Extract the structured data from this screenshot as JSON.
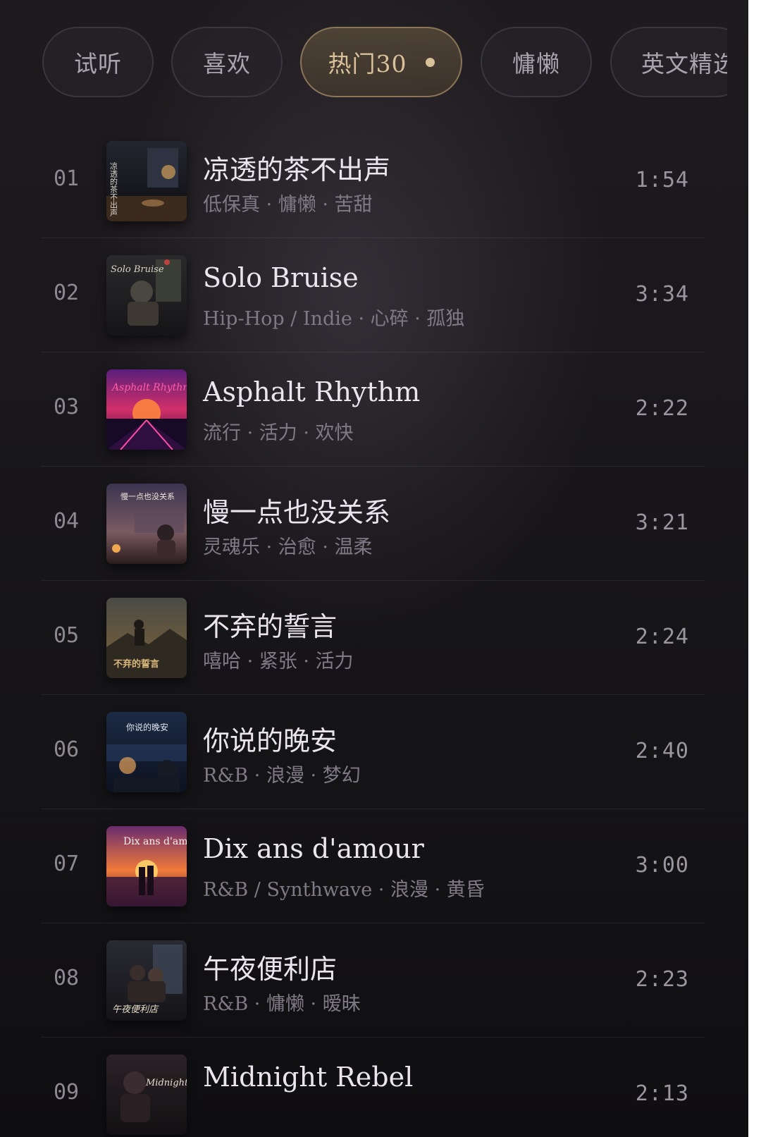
{
  "tabs": [
    {
      "label": "试听"
    },
    {
      "label": "喜欢"
    },
    {
      "label": "热门30"
    },
    {
      "label": "慵懒"
    },
    {
      "label": "英文精选"
    }
  ],
  "active_tab": "热门30",
  "tracks": [
    {
      "num": "01",
      "title": "凉透的茶不出声",
      "tags": "低保真 · 慵懒 · 苦甜",
      "duration": "1:54",
      "cover_text": "凉透的茶不出声"
    },
    {
      "num": "02",
      "title": "Solo Bruise",
      "tags": "Hip-Hop / Indie · 心碎 · 孤独",
      "duration": "3:34",
      "cover_text": "Solo Bruise"
    },
    {
      "num": "03",
      "title": "Asphalt Rhythm",
      "tags": "流行 · 活力 · 欢快",
      "duration": "2:22",
      "cover_text": "Asphalt Rhythm"
    },
    {
      "num": "04",
      "title": "慢一点也没关系",
      "tags": "灵魂乐 · 治愈 · 温柔",
      "duration": "3:21",
      "cover_text": "慢一点也没关系"
    },
    {
      "num": "05",
      "title": "不弃的誓言",
      "tags": "嘻哈 · 紧张 · 活力",
      "duration": "2:24",
      "cover_text": "不弃的誓言"
    },
    {
      "num": "06",
      "title": "你说的晚安",
      "tags": "R&B · 浪漫 · 梦幻",
      "duration": "2:40",
      "cover_text": "你说的晚安"
    },
    {
      "num": "07",
      "title": "Dix ans d'amour",
      "tags": "R&B / Synthwave · 浪漫 · 黄昏",
      "duration": "3:00",
      "cover_text": "Dix ans d'amour"
    },
    {
      "num": "08",
      "title": "午夜便利店",
      "tags": "R&B · 慵懒 · 暧昧",
      "duration": "2:23",
      "cover_text": "午夜便利店"
    },
    {
      "num": "09",
      "title": "Midnight Rebel",
      "tags": "",
      "duration": "2:13",
      "cover_text": "Midnight Rebel"
    }
  ],
  "colors": {
    "background": "#1a181c",
    "active_tab_text": "#d9c19a",
    "active_tab_border": "#8a7556",
    "title_text": "#ebe6ee",
    "tag_text": "#7f7a85"
  }
}
